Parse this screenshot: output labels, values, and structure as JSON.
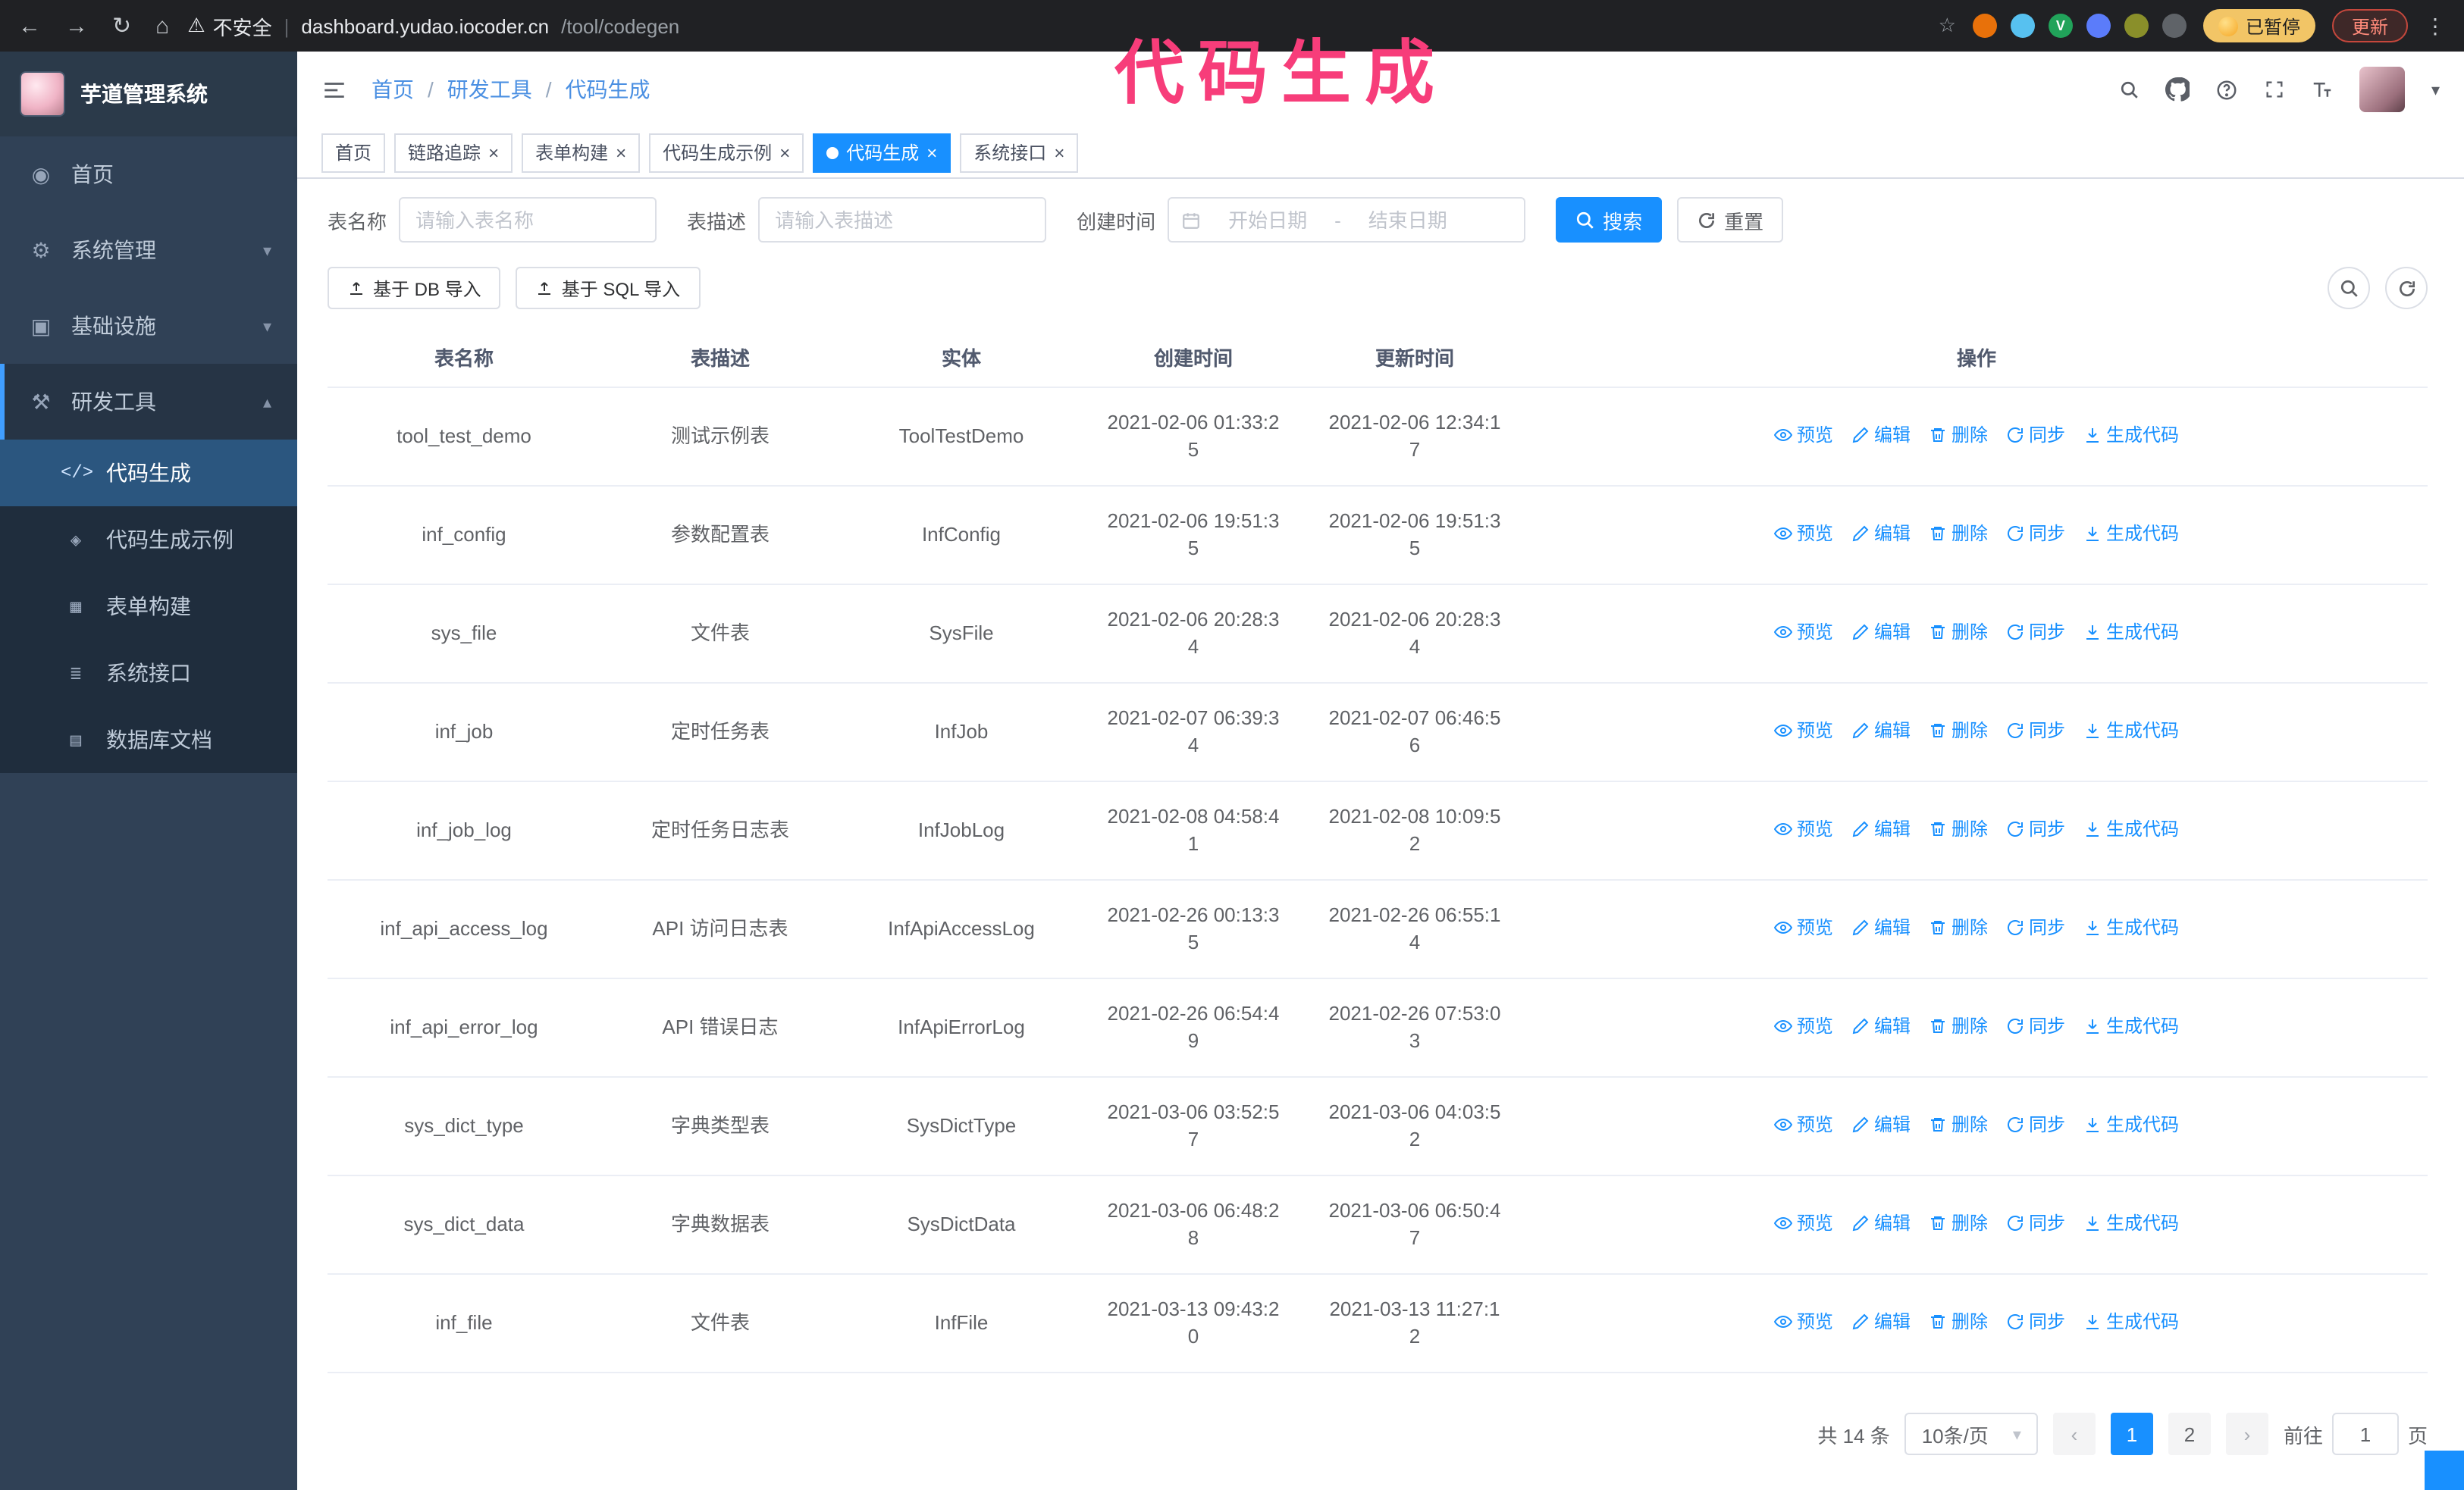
{
  "colors": {
    "accent": "#1890ff",
    "annotation_pink": "#f73d7a",
    "sidebar_bg": "#304156",
    "submenu_bg": "#1f2d3d"
  },
  "browser": {
    "nav_icons": [
      "back-icon",
      "forward-icon",
      "reload-icon",
      "home-icon"
    ],
    "security_warning": "不安全",
    "url_host": "dashboard.yudao.iocoder.cn",
    "url_path": "/tool/codegen",
    "extensions": [
      {
        "name": "extension-orange",
        "color": "#e8710a",
        "letter": ""
      },
      {
        "name": "extension-cyan",
        "color": "#57c1f0",
        "letter": ""
      },
      {
        "name": "extension-green-v",
        "color": "#21a35a",
        "letter": "V"
      },
      {
        "name": "extension-blue",
        "color": "#5b7cfa",
        "letter": ""
      },
      {
        "name": "extension-olive",
        "color": "#8a8f2a",
        "letter": ""
      },
      {
        "name": "extension-dark",
        "color": "#5f6368",
        "letter": ""
      }
    ],
    "paused_badge": "已暂停",
    "update_button": "更新"
  },
  "annotation": {
    "text": "代码生成"
  },
  "sidebar": {
    "logo_title": "芋道管理系统",
    "items": [
      {
        "label": "首页",
        "icon": "dashboard-icon",
        "chevron": "",
        "open": false
      },
      {
        "label": "系统管理",
        "icon": "gear-icon",
        "chevron": "down",
        "open": false
      },
      {
        "label": "基础设施",
        "icon": "infra-icon",
        "chevron": "down",
        "open": false
      },
      {
        "label": "研发工具",
        "icon": "tools-icon",
        "chevron": "up",
        "open": true
      }
    ],
    "submenu": [
      {
        "label": "代码生成",
        "icon": "code-icon",
        "active": true
      },
      {
        "label": "代码生成示例",
        "icon": "example-icon",
        "active": false
      },
      {
        "label": "表单构建",
        "icon": "form-icon",
        "active": false
      },
      {
        "label": "系统接口",
        "icon": "api-icon",
        "active": false
      },
      {
        "label": "数据库文档",
        "icon": "doc-icon",
        "active": false
      }
    ]
  },
  "header": {
    "breadcrumb": [
      "首页",
      "研发工具",
      "代码生成"
    ],
    "right_icons": [
      "search-icon",
      "github-icon",
      "question-icon",
      "fullscreen-icon",
      "fontsize-icon"
    ]
  },
  "tabs": [
    {
      "label": "首页",
      "closable": false,
      "active": false
    },
    {
      "label": "链路追踪",
      "closable": true,
      "active": false
    },
    {
      "label": "表单构建",
      "closable": true,
      "active": false
    },
    {
      "label": "代码生成示例",
      "closable": true,
      "active": false
    },
    {
      "label": "代码生成",
      "closable": true,
      "active": true
    },
    {
      "label": "系统接口",
      "closable": true,
      "active": false
    }
  ],
  "filters": {
    "table_name_label": "表名称",
    "table_name_placeholder": "请输入表名称",
    "table_desc_label": "表描述",
    "table_desc_placeholder": "请输入表描述",
    "create_time_label": "创建时间",
    "start_date_placeholder": "开始日期",
    "end_date_placeholder": "结束日期",
    "range_separator": "-",
    "search_button": "搜索",
    "reset_button": "重置"
  },
  "toolbar": {
    "import_db_button": "基于 DB 导入",
    "import_sql_button": "基于 SQL 导入",
    "circle_buttons": [
      "search-icon",
      "refresh-icon"
    ]
  },
  "table": {
    "columns": [
      "表名称",
      "表描述",
      "实体",
      "创建时间",
      "更新时间",
      "操作"
    ],
    "actions": [
      {
        "label": "预览",
        "icon": "eye-icon",
        "name": "preview-action"
      },
      {
        "label": "编辑",
        "icon": "edit-icon",
        "name": "edit-action"
      },
      {
        "label": "删除",
        "icon": "delete-icon",
        "name": "delete-action"
      },
      {
        "label": "同步",
        "icon": "sync-icon",
        "name": "sync-action"
      },
      {
        "label": "生成代码",
        "icon": "download-icon",
        "name": "generate-code-action"
      }
    ],
    "rows": [
      {
        "name": "tool_test_demo",
        "desc": "测试示例表",
        "entity": "ToolTestDemo",
        "created": "2021-02-06 01:33:25",
        "updated": "2021-02-06 12:34:17"
      },
      {
        "name": "inf_config",
        "desc": "参数配置表",
        "entity": "InfConfig",
        "created": "2021-02-06 19:51:35",
        "updated": "2021-02-06 19:51:35"
      },
      {
        "name": "sys_file",
        "desc": "文件表",
        "entity": "SysFile",
        "created": "2021-02-06 20:28:34",
        "updated": "2021-02-06 20:28:34"
      },
      {
        "name": "inf_job",
        "desc": "定时任务表",
        "entity": "InfJob",
        "created": "2021-02-07 06:39:34",
        "updated": "2021-02-07 06:46:56"
      },
      {
        "name": "inf_job_log",
        "desc": "定时任务日志表",
        "entity": "InfJobLog",
        "created": "2021-02-08 04:58:41",
        "updated": "2021-02-08 10:09:52"
      },
      {
        "name": "inf_api_access_log",
        "desc": "API 访问日志表",
        "entity": "InfApiAccessLog",
        "created": "2021-02-26 00:13:35",
        "updated": "2021-02-26 06:55:14"
      },
      {
        "name": "inf_api_error_log",
        "desc": "API 错误日志",
        "entity": "InfApiErrorLog",
        "created": "2021-02-26 06:54:49",
        "updated": "2021-02-26 07:53:03"
      },
      {
        "name": "sys_dict_type",
        "desc": "字典类型表",
        "entity": "SysDictType",
        "created": "2021-03-06 03:52:57",
        "updated": "2021-03-06 04:03:52"
      },
      {
        "name": "sys_dict_data",
        "desc": "字典数据表",
        "entity": "SysDictData",
        "created": "2021-03-06 06:48:28",
        "updated": "2021-03-06 06:50:47"
      },
      {
        "name": "inf_file",
        "desc": "文件表",
        "entity": "InfFile",
        "created": "2021-03-13 09:43:20",
        "updated": "2021-03-13 11:27:12"
      }
    ]
  },
  "pagination": {
    "total": "共 14 条",
    "page_size": "10条/页",
    "pages": [
      "1",
      "2"
    ],
    "active_page": "1",
    "goto_prefix": "前往",
    "goto_value": "1",
    "goto_suffix": "页"
  }
}
